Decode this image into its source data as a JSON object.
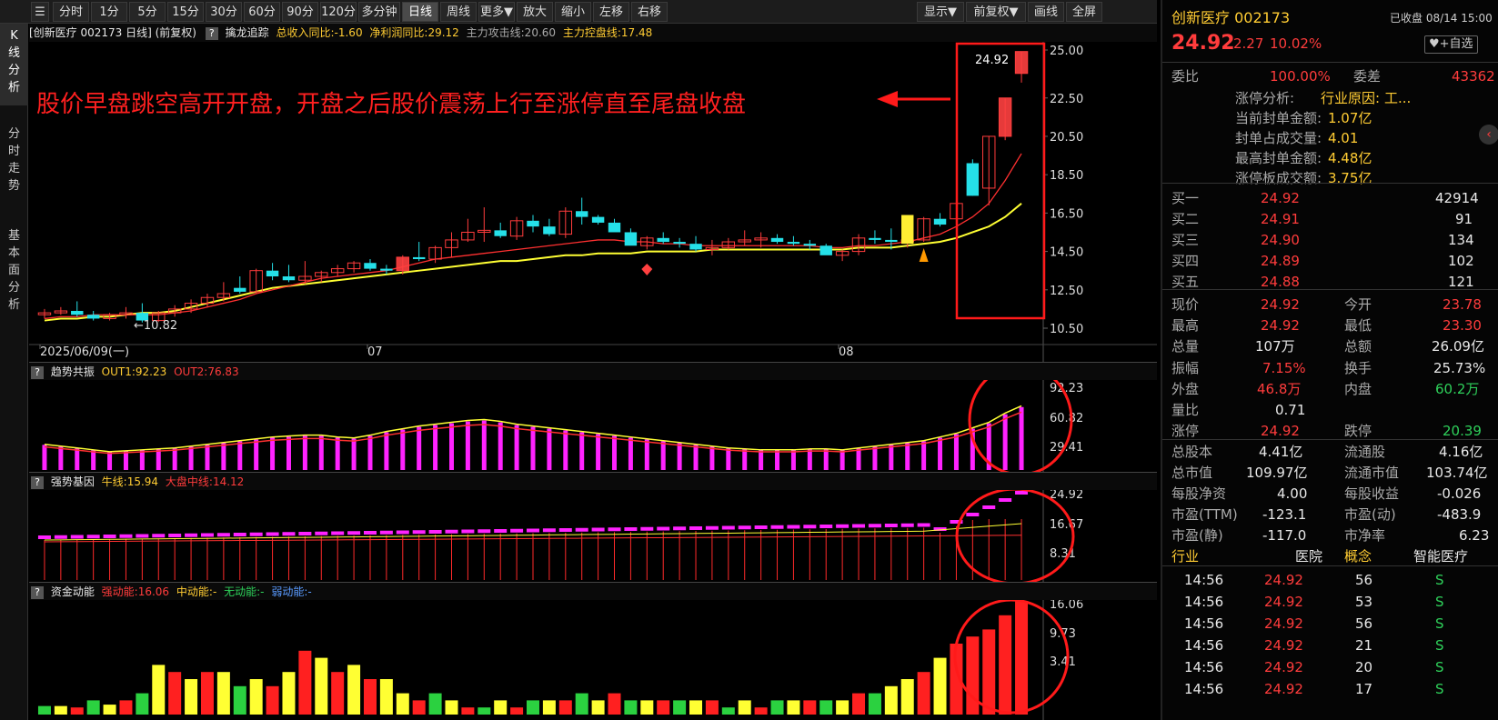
{
  "toolbar": {
    "periods": [
      "分时",
      "1分",
      "5分",
      "15分",
      "30分",
      "60分",
      "90分",
      "120分",
      "多分钟",
      "日线",
      "周线",
      "更多▼"
    ],
    "actions": [
      "放大",
      "缩小",
      "左移",
      "右移"
    ],
    "right_actions": [
      "显示▼",
      "前复权▼",
      "画线",
      "全屏"
    ]
  },
  "left_tabs": [
    "K线分析",
    "分时走势",
    "基本面分析"
  ],
  "main_header": {
    "title": "[创新医疗 002173 日线] (前复权)",
    "indicator": "擒龙追踪",
    "rev": "总收入同比:-1.60",
    "profit": "净利润同比:29.12",
    "attack": "主力攻击线:20.60",
    "control": "主力控盘线:17.48"
  },
  "annotation": "股价早盘跳空高开开盘，开盘之后股价震荡上行至涨停直至尾盘收盘",
  "price_axis": [
    "25.00",
    "22.50",
    "20.50",
    "18.50",
    "16.50",
    "14.50",
    "12.50",
    "10.50"
  ],
  "price_labels": {
    "high": "24.92",
    "low": "10.82"
  },
  "date_axis": [
    "2025/06/09(一)",
    "07",
    "08"
  ],
  "sub1": {
    "name": "趋势共振",
    "out1": "OUT1:92.23",
    "out2": "OUT2:76.83",
    "axis": [
      "92.23",
      "60.82",
      "29.41"
    ]
  },
  "sub2": {
    "name": "强势基因",
    "bull": "牛线:15.94",
    "market": "大盘中线:14.12",
    "axis": [
      "24.92",
      "16.67",
      "8.31"
    ]
  },
  "sub3": {
    "name": "资金动能",
    "strong": "强动能:16.06",
    "mid": "中动能:-",
    "none": "无动能:-",
    "weak": "弱动能:-",
    "axis": [
      "16.06",
      "9.73",
      "3.41"
    ]
  },
  "chart_data": {
    "type": "candlestick",
    "ohlc": [
      [
        11.2,
        11.5,
        11.0,
        11.3
      ],
      [
        11.3,
        11.6,
        11.2,
        11.4
      ],
      [
        11.4,
        11.9,
        11.1,
        11.2
      ],
      [
        11.2,
        11.4,
        10.9,
        11.0
      ],
      [
        11.0,
        11.3,
        10.9,
        11.2
      ],
      [
        11.2,
        11.6,
        11.0,
        11.3
      ],
      [
        11.3,
        11.8,
        10.8,
        10.9
      ],
      [
        10.9,
        11.4,
        10.82,
        11.3
      ],
      [
        11.3,
        11.7,
        11.1,
        11.5
      ],
      [
        11.5,
        12.0,
        11.3,
        11.8
      ],
      [
        11.8,
        12.3,
        11.6,
        12.1
      ],
      [
        12.1,
        12.9,
        11.9,
        12.3
      ],
      [
        12.6,
        13.2,
        12.3,
        12.4
      ],
      [
        12.4,
        13.6,
        12.3,
        13.5
      ],
      [
        13.5,
        13.9,
        13.0,
        13.2
      ],
      [
        13.2,
        13.8,
        12.9,
        13.0
      ],
      [
        13.0,
        14.0,
        12.8,
        13.2
      ],
      [
        13.2,
        13.5,
        12.9,
        13.4
      ],
      [
        13.4,
        13.8,
        13.2,
        13.6
      ],
      [
        13.6,
        14.0,
        13.4,
        13.9
      ],
      [
        13.9,
        14.1,
        13.5,
        13.6
      ],
      [
        13.6,
        13.8,
        13.3,
        13.5
      ],
      [
        13.5,
        14.3,
        13.3,
        14.2
      ],
      [
        14.2,
        15.0,
        14.0,
        14.1
      ],
      [
        14.1,
        14.8,
        13.9,
        14.7
      ],
      [
        14.7,
        15.5,
        14.2,
        15.1
      ],
      [
        15.1,
        16.2,
        15.0,
        15.5
      ],
      [
        15.5,
        16.8,
        15.0,
        15.6
      ],
      [
        15.6,
        16.0,
        15.2,
        15.3
      ],
      [
        15.3,
        16.3,
        15.1,
        16.1
      ],
      [
        16.1,
        16.4,
        15.5,
        15.8
      ],
      [
        15.8,
        16.2,
        15.3,
        15.4
      ],
      [
        15.4,
        16.8,
        15.2,
        16.6
      ],
      [
        16.6,
        17.3,
        15.9,
        16.3
      ],
      [
        16.3,
        16.4,
        15.9,
        16.0
      ],
      [
        16.0,
        16.2,
        15.6,
        15.5
      ],
      [
        15.5,
        15.7,
        15.0,
        14.8
      ],
      [
        14.8,
        15.3,
        14.6,
        15.2
      ],
      [
        15.2,
        15.5,
        14.9,
        15.0
      ],
      [
        15.0,
        15.2,
        14.7,
        14.9
      ],
      [
        14.9,
        15.3,
        14.5,
        14.6
      ],
      [
        14.6,
        15.1,
        14.3,
        14.7
      ],
      [
        14.7,
        15.2,
        14.6,
        15.0
      ],
      [
        15.0,
        15.6,
        14.8,
        15.1
      ],
      [
        15.1,
        15.5,
        14.7,
        15.2
      ],
      [
        15.2,
        15.4,
        14.9,
        15.0
      ],
      [
        15.0,
        15.3,
        14.8,
        14.9
      ],
      [
        14.9,
        15.1,
        14.6,
        14.8
      ],
      [
        14.8,
        14.9,
        14.4,
        14.3
      ],
      [
        14.3,
        14.6,
        14.0,
        14.5
      ],
      [
        14.5,
        15.4,
        14.3,
        15.2
      ],
      [
        15.2,
        15.6,
        14.9,
        15.1
      ],
      [
        15.1,
        15.7,
        14.6,
        15.0
      ],
      [
        15.0,
        15.3,
        14.7,
        15.1
      ],
      [
        15.1,
        16.3,
        15.0,
        16.2
      ],
      [
        16.2,
        16.5,
        15.8,
        15.9
      ],
      [
        16.2,
        17.1,
        15.9,
        17.0
      ],
      [
        19.1,
        19.3,
        17.4,
        17.4
      ],
      [
        17.8,
        20.5,
        16.9,
        20.5
      ],
      [
        20.5,
        22.5,
        20.3,
        22.5
      ],
      [
        23.78,
        24.92,
        23.3,
        24.92
      ]
    ],
    "ma_yellow": [
      10.9,
      11.0,
      11.0,
      11.1,
      11.1,
      11.2,
      11.3,
      11.3,
      11.4,
      11.6,
      11.8,
      12.0,
      12.2,
      12.4,
      12.6,
      12.7,
      12.8,
      12.9,
      13.0,
      13.1,
      13.2,
      13.3,
      13.4,
      13.5,
      13.6,
      13.7,
      13.8,
      13.9,
      14.0,
      14.0,
      14.1,
      14.2,
      14.3,
      14.3,
      14.4,
      14.4,
      14.4,
      14.5,
      14.5,
      14.5,
      14.5,
      14.6,
      14.6,
      14.6,
      14.6,
      14.6,
      14.6,
      14.6,
      14.6,
      14.6,
      14.7,
      14.7,
      14.7,
      14.8,
      14.9,
      15.0,
      15.2,
      15.5,
      15.8,
      16.3,
      17.0
    ],
    "ma_red": [
      11.0,
      11.1,
      11.1,
      11.2,
      11.2,
      11.2,
      11.2,
      11.2,
      11.3,
      11.4,
      11.6,
      11.8,
      12.0,
      12.3,
      12.5,
      12.7,
      12.9,
      13.1,
      13.2,
      13.3,
      13.4,
      13.5,
      13.7,
      13.9,
      14.1,
      14.2,
      14.3,
      14.4,
      14.5,
      14.6,
      14.7,
      14.8,
      14.9,
      15.0,
      15.1,
      15.1,
      15.0,
      15.0,
      14.9,
      14.9,
      14.8,
      14.8,
      14.8,
      14.8,
      14.8,
      14.8,
      14.8,
      14.8,
      14.7,
      14.7,
      14.8,
      14.8,
      14.9,
      15.0,
      15.2,
      15.4,
      15.8,
      16.3,
      17.0,
      18.2,
      19.6
    ],
    "sub1_values": [
      28,
      26,
      24,
      22,
      20,
      21,
      22,
      23,
      24,
      26,
      28,
      30,
      32,
      34,
      36,
      37,
      38,
      38,
      36,
      35,
      38,
      42,
      45,
      48,
      50,
      52,
      54,
      55,
      53,
      50,
      48,
      46,
      44,
      42,
      40,
      38,
      36,
      34,
      32,
      30,
      28,
      26,
      24,
      23,
      22,
      22,
      22,
      23,
      23,
      22,
      24,
      26,
      28,
      30,
      32,
      36,
      40,
      46,
      52,
      62,
      70,
      92.23
    ]
  }
}
